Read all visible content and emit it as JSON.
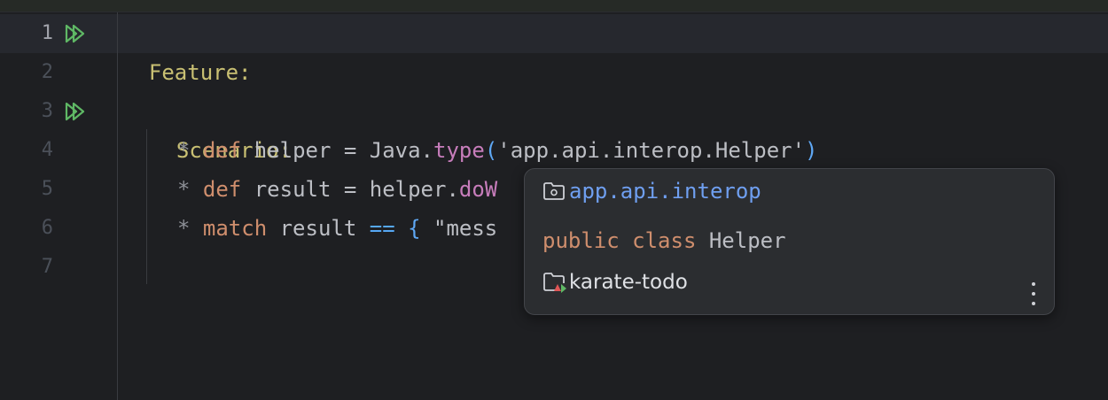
{
  "editor": {
    "line_numbers": [
      "1",
      "2",
      "3",
      "4",
      "5",
      "6",
      "7"
    ],
    "active_line": "1",
    "lines": {
      "l1": {
        "keyword": "Feature:"
      },
      "l3": {
        "keyword": "Scenario:"
      },
      "l4": {
        "star": "*",
        "def": "def",
        "text1": " helper = Java.",
        "fn": "type",
        "open": "(",
        "str": "'app.api.interop.Helper'",
        "close": ")"
      },
      "l5": {
        "star": "*",
        "def": "def",
        "text1": " result = helper.",
        "fn": "doW"
      },
      "l6": {
        "star": "*",
        "keyword": "match",
        "text1": " result ",
        "op": "==",
        "space": " ",
        "brace": "{",
        "str": " \"mess"
      }
    }
  },
  "popup": {
    "package": "app.api.interop",
    "declaration_keyword": "public class",
    "declaration_name": " Helper",
    "module": "karate-todo",
    "icons": {
      "package": "package-folder-icon",
      "module": "module-folder-icon",
      "more": "more-vertical-icon"
    }
  },
  "colors": {
    "background": "#1e1f22",
    "keyword_feature": "#c9c073",
    "keyword_def": "#cf8e6d",
    "function": "#c77dbb",
    "package_link": "#6f9ff0",
    "run_icon": "#5fb865"
  }
}
